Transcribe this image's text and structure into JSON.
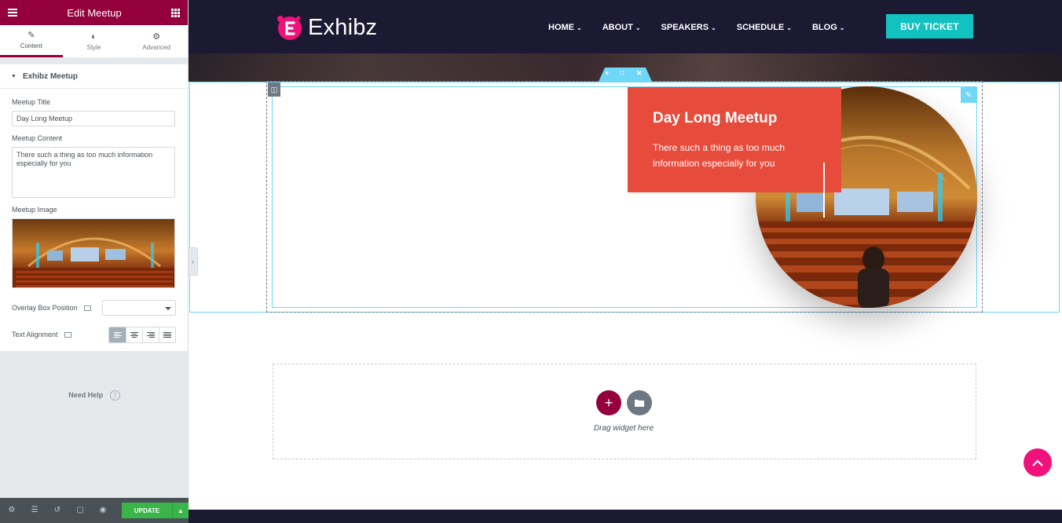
{
  "panel": {
    "title": "Edit Meetup",
    "tabs": [
      {
        "label": "Content",
        "icon": "pencil-icon"
      },
      {
        "label": "Style",
        "icon": "half-circle-icon"
      },
      {
        "label": "Advanced",
        "icon": "gear-icon"
      }
    ],
    "section_title": "Exhibz Meetup",
    "fields": {
      "title_label": "Meetup Title",
      "title_value": "Day Long Meetup",
      "content_label": "Meetup Content",
      "content_value": "There such a thing as too much information especially for you",
      "image_label": "Meetup Image",
      "overlay_label": "Overlay Box Position",
      "overlay_value": "",
      "alignment_label": "Text Alignment",
      "alignment_options": [
        "left",
        "center",
        "right",
        "justify"
      ],
      "alignment_selected": "left"
    },
    "need_help": "Need Help",
    "footer": {
      "icons": [
        "settings-icon",
        "layers-icon",
        "history-icon",
        "responsive-icon",
        "preview-eye-icon"
      ],
      "update_label": "UPDATE"
    }
  },
  "site": {
    "logo_text": "Exhibz",
    "menu": [
      {
        "label": "HOME"
      },
      {
        "label": "ABOUT"
      },
      {
        "label": "SPEAKERS"
      },
      {
        "label": "SCHEDULE"
      },
      {
        "label": "BLOG"
      }
    ],
    "buy_label": "BUY TICKET",
    "colors": {
      "nav_bg": "#1c1933",
      "accent_teal": "#12c2c0",
      "accent_pink": "#f0127a",
      "overlay_red": "#e74b3c",
      "editor_maroon": "#93003c"
    }
  },
  "meetup": {
    "title": "Day Long Meetup",
    "content": "There such a thing as too much information especially for you"
  },
  "editor": {
    "drag_text": "Drag widget here"
  }
}
